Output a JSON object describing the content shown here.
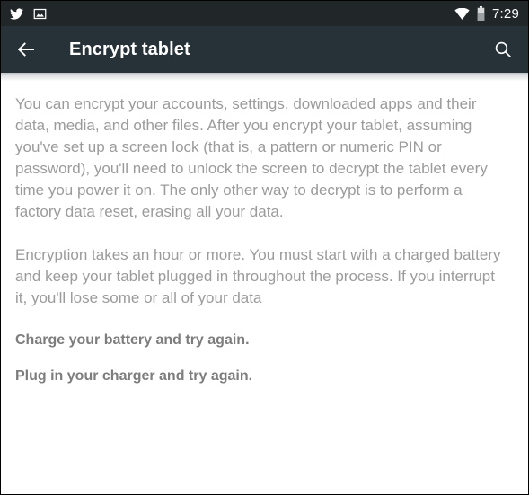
{
  "status_bar": {
    "left_icons": [
      {
        "name": "twitter-icon",
        "label": "Twitter"
      },
      {
        "name": "image-icon",
        "label": "Screenshot captured"
      }
    ],
    "right_icons": [
      {
        "name": "wifi-icon",
        "label": "Wi-Fi"
      },
      {
        "name": "battery-icon",
        "label": "Battery"
      }
    ],
    "time": "7:29",
    "background_color": "#212629"
  },
  "app_bar": {
    "back_label": "Navigate up",
    "title": "Encrypt tablet",
    "search_label": "Search",
    "background_color": "#263238",
    "title_color": "#ffffff"
  },
  "content": {
    "paragraphs": [
      "You can encrypt your accounts, settings, downloaded apps and their data, media, and other files. After you encrypt your tablet, assuming you've set up a screen lock (that is, a pattern or numeric PIN or password), you'll need to unlock the screen to decrypt the tablet every time you power it on. The only other way to decrypt is to perform a factory data reset, erasing all your data.",
      "Encryption takes an hour or more. You must start with a charged battery and keep your tablet plugged in throughout the process. If you interrupt it, you'll lose some or all of your data"
    ],
    "warnings": [
      "Charge your battery and try again.",
      "Plug in your charger and try again."
    ],
    "body_text_color": "#9b9b9b",
    "warning_text_color": "#7d7d7d",
    "background_color": "#ffffff"
  }
}
